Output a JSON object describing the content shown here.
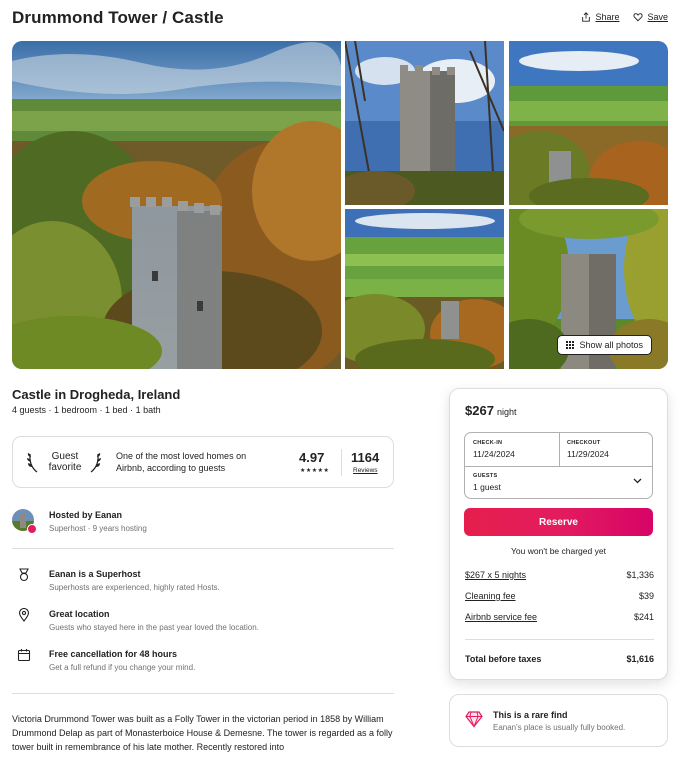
{
  "header": {
    "title": "Drummond Tower / Castle",
    "share_label": "Share",
    "save_label": "Save",
    "share_icon": "share-icon",
    "save_icon": "heart-icon"
  },
  "photos": {
    "show_all_label": "Show all photos"
  },
  "listing": {
    "subtitle": "Castle in Drogheda, Ireland",
    "facts": "4 guests · 1 bedroom · 1 bed · 1 bath"
  },
  "guest_favorite": {
    "label_line1": "Guest",
    "label_line2": "favorite",
    "description": "One of the most loved homes on Airbnb, according to guests",
    "rating": "4.97",
    "stars": "★★★★★",
    "reviews_count": "1164",
    "reviews_label": "Reviews"
  },
  "host": {
    "name": "Hosted by Eanan",
    "meta": "Superhost · 9 years hosting"
  },
  "highlights": [
    {
      "icon": "medal-icon",
      "title": "Eanan is a Superhost",
      "description": "Superhosts are experienced, highly rated Hosts."
    },
    {
      "icon": "location-pin-icon",
      "title": "Great location",
      "description": "Guests who stayed here in the past year loved the location."
    },
    {
      "icon": "calendar-icon",
      "title": "Free cancellation for 48 hours",
      "description": "Get a full refund if you change your mind."
    }
  ],
  "description": "Victoria Drummond Tower was built as a Folly Tower in the victorian period in 1858 by William Drummond Delap as part of Monasterboice House & Demesne.  The tower is regarded as a folly tower built in remembrance of his late mother. Recently restored into",
  "booking": {
    "price": "$267",
    "price_unit": "night",
    "checkin_label": "CHECK-IN",
    "checkin_value": "11/24/2024",
    "checkout_label": "CHECKOUT",
    "checkout_value": "11/29/2024",
    "guests_label": "GUESTS",
    "guests_value": "1 guest",
    "reserve_label": "Reserve",
    "no_charge": "You won't be charged yet",
    "fees": [
      {
        "label": "$267 x 5 nights",
        "amount": "$1,336"
      },
      {
        "label": "Cleaning fee",
        "amount": "$39"
      },
      {
        "label": "Airbnb service fee",
        "amount": "$241"
      }
    ],
    "total_label": "Total before taxes",
    "total_amount": "$1,616",
    "accent_color": "#e31c5f"
  },
  "rare_find": {
    "title": "This is a rare find",
    "description": "Eanan's place is usually fully booked.",
    "icon": "diamond-icon"
  }
}
